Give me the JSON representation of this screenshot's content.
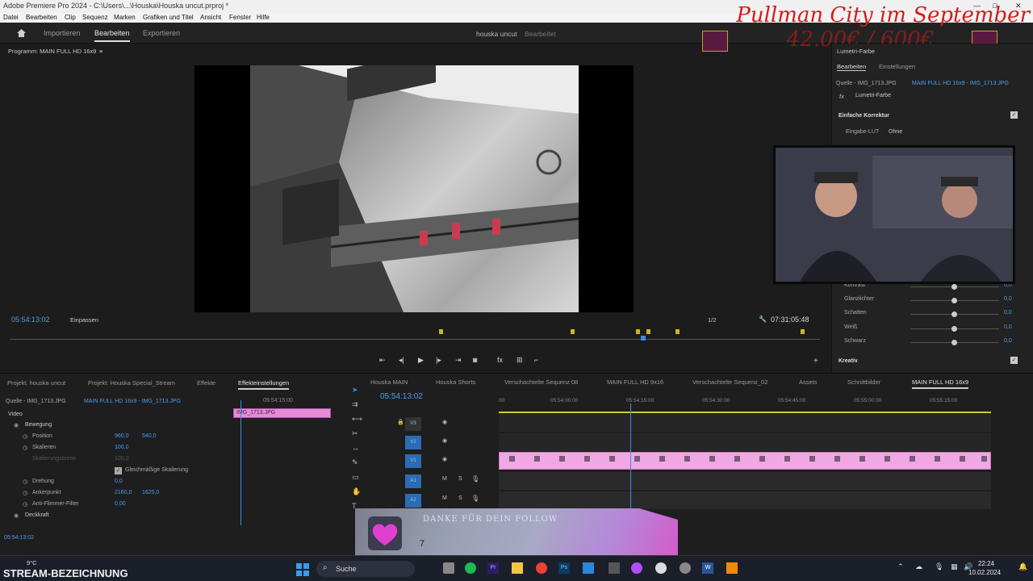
{
  "window": {
    "title": "Adobe Premiere Pro 2024 - C:\\Users\\...\\Houska\\Houska uncut.prproj *",
    "controls": [
      "—",
      "□",
      "✕"
    ]
  },
  "menu": [
    "Datei",
    "Bearbeiten",
    "Clip",
    "Sequenz",
    "Marken",
    "Grafiken und Titel",
    "Ansicht",
    "Fenster",
    "Hilfe"
  ],
  "workspace": {
    "tabs": [
      "Importieren",
      "Bearbeiten",
      "Exportieren"
    ],
    "active": "Bearbeiten",
    "project_name": "houska uncut",
    "project_state": "Bearbeitet"
  },
  "overlay": {
    "headline": "Pullman City im September",
    "price": "42.00€ / 600€"
  },
  "program_monitor": {
    "title": "Programm: MAIN FULL HD 16x9",
    "timecode": "05:54:13:02",
    "fit": "Einpassen",
    "quality": "1/2",
    "duration": "07:31:05:48"
  },
  "lumetri": {
    "panel_title": "Lumetri-Farbe",
    "tabs": [
      "Bearbeiten",
      "Einstellungen"
    ],
    "source": "Quelle - IMG_1713.JPG",
    "sequence": "MAIN FULL HD 16x9 - IMG_1713.JPG",
    "effect": "Lumetri-Farbe",
    "section_basic": "Einfache Korrektur",
    "lut_label": "Eingabe-LUT",
    "lut_value": "Ohne",
    "sliders": [
      {
        "label": "Kontrast",
        "value": "0,0"
      },
      {
        "label": "Glanzlichter",
        "value": "0,0"
      },
      {
        "label": "Schatten",
        "value": "0,0"
      },
      {
        "label": "Weiß",
        "value": "0,0"
      },
      {
        "label": "Schwarz",
        "value": "0,0"
      }
    ],
    "section_creative": "Kreativ"
  },
  "bottom_tabs": [
    "Projekt: houska uncut",
    "Projekt: Houska Special_Stream",
    "Effekte",
    "Effekteinstellungen"
  ],
  "effect_controls": {
    "source": "Quelle - IMG_1713.JPG",
    "sequence": "MAIN FULL HD 16x9 - IMG_1713.JPG",
    "mini_timecode": "05:54:15:00",
    "clip_name": "IMG_1713.JPG",
    "video_label": "Video",
    "motion": "Bewegung",
    "position_label": "Position",
    "position_x": "960,0",
    "position_y": "540,0",
    "scale_label": "Skalieren",
    "scale_value": "100,0",
    "scale_width_label": "Skalierungsbreite",
    "scale_width_value": "100,0",
    "uniform_label": "Gleichmäßige Skalierung",
    "rotation_label": "Drehung",
    "rotation_value": "0,0",
    "anchor_label": "Ankerpunkt",
    "anchor_x": "2160,0",
    "anchor_y": "1620,0",
    "flicker_label": "Anti-Flimmer-Filter",
    "flicker_value": "0,00",
    "opacity_label": "Deckkraft",
    "footer_timecode": "05:54:13:02"
  },
  "timeline": {
    "tabs": [
      "Houska MAIN",
      "Houska Shorts",
      "Verschachtelte Sequenz 08",
      "MAIN FULL HD 9x16",
      "Verschachtelte Sequenz_02",
      "Assets",
      "Schnittbilder",
      "MAIN FULL HD 16x9"
    ],
    "active_tab": "MAIN FULL HD 16x9",
    "timecode": "05:54:13:02",
    "ruler": [
      "00",
      "05:54:00:00",
      "05:54:15:00",
      "05:54:30:00",
      "05:54:45:00",
      "05:55:00:00",
      "05:55:15:00"
    ],
    "tracks": [
      "V3",
      "V2",
      "V1",
      "A1",
      "A2"
    ]
  },
  "follow_alert": {
    "text": "DANKE FÜR DEIN FOLLOW",
    "name": "7"
  },
  "stream_footer": {
    "label": "STREAM-BEZEICHNUNG",
    "weather_temp": "9°C"
  },
  "taskbar": {
    "search": "Suche",
    "time": "22:24",
    "date": "10.02.2024"
  },
  "colors": {
    "accent_blue": "#4a9df0",
    "clip_pink": "#f0a8e4",
    "overlay_red": "#d31c1c"
  }
}
